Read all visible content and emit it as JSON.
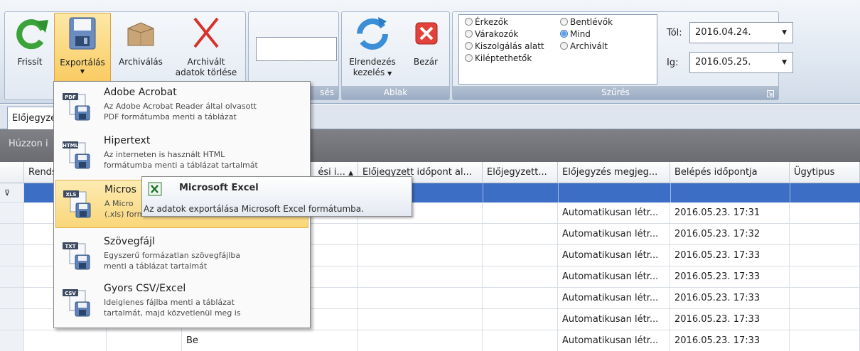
{
  "ribbon": {
    "buttons": {
      "refresh": "Frissít",
      "export": "Exportálás",
      "archive": "Archiválás",
      "delete_archived_1": "Archivált",
      "delete_archived_2": "adatok törlése",
      "layout_1": "Elrendezés",
      "layout_2": "kezelés",
      "close": "Bezár"
    },
    "groups": {
      "search_fragment": "sés",
      "window": "Ablak",
      "filter": "Szűrés"
    },
    "filter": {
      "options": {
        "arrivals": "Érkezők",
        "waiting": "Várakozók",
        "serving": "Kiszolgálás alatt",
        "releasable": "Kiléptethetők",
        "inside": "Bentlévők",
        "all": "Mind",
        "archived": "Archivált"
      },
      "selected": "Mind",
      "from_label": "Tól:",
      "from_value": "2016.04.24.",
      "to_label": "Ig:",
      "to_value": "2016.05.25."
    }
  },
  "tabs": {
    "main": "Előjegyzés"
  },
  "group_panel": {
    "text": "Húzzon i"
  },
  "grid": {
    "headers": [
      "Rends",
      "",
      "ési i...",
      "Előjegyzett időpont al...",
      "Előjegyzett...",
      "Előjegyzés megjeg...",
      "Belépés időpontja",
      "Ügytipus"
    ],
    "rows": [
      {
        "note": "Automatikusan létr...",
        "entry": "2016.05.23. 17:31",
        "col3": ""
      },
      {
        "note": "Automatikusan létr...",
        "entry": "2016.05.23. 17:32",
        "col3": ""
      },
      {
        "note": "Automatikusan létr...",
        "entry": "2016.05.23. 17:33",
        "col3": ""
      },
      {
        "note": "Automatikusan létr...",
        "entry": "2016.05.23. 17:33",
        "col3": ""
      },
      {
        "note": "Automatikusan létr...",
        "entry": "2016.05.23. 17:33",
        "col3": ""
      },
      {
        "note": "Automatikusan létr...",
        "entry": "2016.05.23. 17:33",
        "col3": ""
      },
      {
        "note": "Automatikusan létr...",
        "entry": "2016.05.23. 17:33",
        "col3": "Be"
      }
    ]
  },
  "export_menu": {
    "items": [
      {
        "icon": "PDF",
        "title": "Adobe Acrobat",
        "desc1": "Az Adobe Acrobat Reader által olvasott",
        "desc2": "PDF formátumba menti a táblázat"
      },
      {
        "icon": "HTML",
        "title": "Hipertext",
        "desc1": "Az interneten is használt HTML",
        "desc2": "formátumba menti a táblázat tartalmát"
      },
      {
        "icon": "XLS",
        "title": "Micros",
        "desc1": "A Micro",
        "desc2": "(.xls) formátumba menti a táblázat"
      },
      {
        "icon": "TXT",
        "title": "Szövegfájl",
        "desc1": "Egyszerű formázatlan szövegfájlba",
        "desc2": "menti a táblázat tartalmát"
      },
      {
        "icon": "CSV",
        "title": "Gyors CSV/Excel",
        "desc1": "Ideiglenes fájlba menti a táblázat",
        "desc2": "tartalmát, majd közvetlenül meg is"
      }
    ]
  },
  "tooltip": {
    "title": "Microsoft Excel",
    "desc": "Az adatok exportálása Microsoft  Excel formátumba."
  },
  "colors": {
    "selection": "#3c6ec5",
    "highlight": "#f9d679",
    "accent": "#d9a440"
  }
}
